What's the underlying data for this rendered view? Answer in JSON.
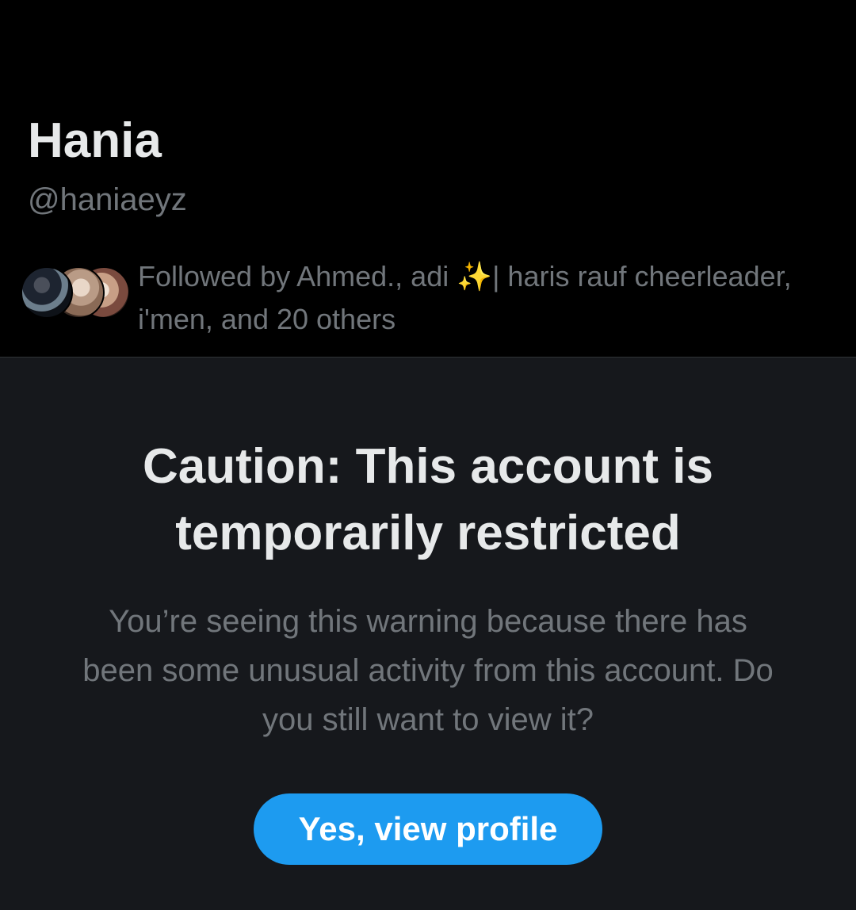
{
  "profile": {
    "display_name": "Hania",
    "handle": "@haniaeyz",
    "followed_by": {
      "text_before": "Followed by Ahmed., adi ",
      "sparkle_emoji": "✨",
      "text_after": "| haris rauf cheerleader, i'men, and 20 others"
    }
  },
  "warning": {
    "title": "Caution: This account is temporarily restricted",
    "body": "You’re seeing this warning because there has been some unusual activity from this account. Do you still want to view it?",
    "button_label": "Yes, view profile"
  },
  "colors": {
    "background": "#000000",
    "panel": "#16181c",
    "primary_text": "#e7e9ea",
    "secondary_text": "#71767b",
    "accent": "#1d9bf0"
  }
}
